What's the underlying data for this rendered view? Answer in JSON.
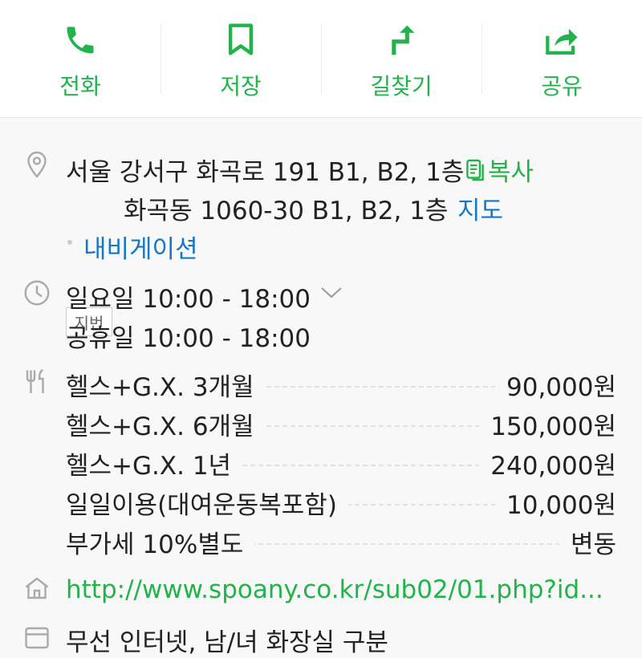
{
  "actions": [
    {
      "label": "전화",
      "icon": "phone-icon"
    },
    {
      "label": "저장",
      "icon": "bookmark-icon"
    },
    {
      "label": "길찾기",
      "icon": "directions-icon"
    },
    {
      "label": "공유",
      "icon": "share-icon"
    }
  ],
  "address": {
    "road": "서울 강서구 화곡로 191 B1, B2, 1층",
    "copy_label": "복사",
    "jibun_badge": "지번",
    "jibun": "화곡동 1060-30 B1, B2, 1층",
    "map_label": "지도",
    "navigation_label": "내비게이션"
  },
  "hours": {
    "line1": "일요일 10:00 - 18:00",
    "line2": "공휴일 10:00 - 18:00"
  },
  "menu": [
    {
      "name": "헬스+G.X. 3개월",
      "price": "90,000원"
    },
    {
      "name": "헬스+G.X. 6개월",
      "price": "150,000원"
    },
    {
      "name": "헬스+G.X. 1년",
      "price": "240,000원"
    },
    {
      "name": "일일이용(대여운동복포함)",
      "price": "10,000원"
    },
    {
      "name": "부가세 10%별도",
      "price": "변동"
    }
  ],
  "homepage": "http://www.spoany.co.kr/sub02/01.php?id...",
  "facilities": "무선 인터넷, 남/녀 화장실 구분",
  "colors": {
    "accent": "#22b34a",
    "link": "#1677c9"
  }
}
